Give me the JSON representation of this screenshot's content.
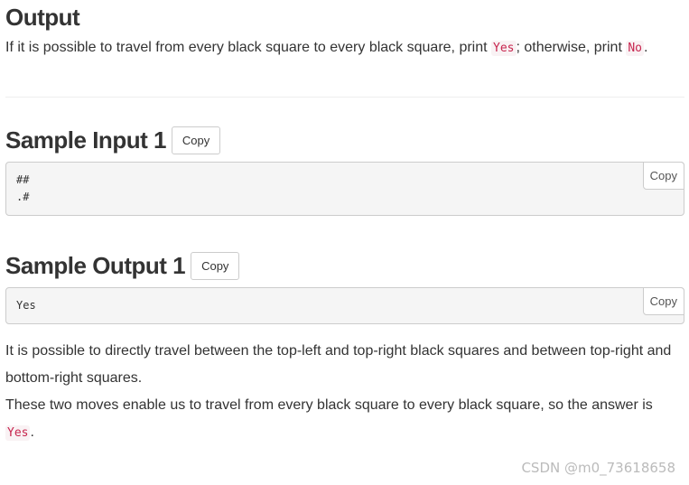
{
  "output": {
    "title": "Output",
    "text1": "If it is possible to travel from every black square to every black square, print ",
    "yes": "Yes",
    "text2": "; otherwise, print ",
    "no": "No",
    "text3": "."
  },
  "sample_input": {
    "title": "Sample Input 1",
    "copy": "Copy",
    "content": "##\n.#",
    "pre_copy": "Copy"
  },
  "sample_output": {
    "title": "Sample Output 1",
    "copy": "Copy",
    "content": "Yes",
    "pre_copy": "Copy"
  },
  "explanation": {
    "line1": "It is possible to directly travel between the top-left and top-right black squares and between top-right and bottom-right squares.",
    "line2a": "These two moves enable us to travel from every black square to every black square, so the answer is ",
    "yes": "Yes",
    "line2b": "."
  },
  "watermark": "CSDN @m0_73618658"
}
